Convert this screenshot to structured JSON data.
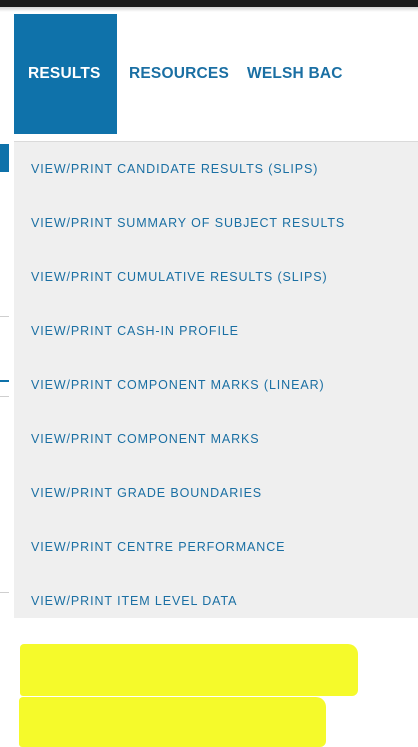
{
  "nav": {
    "tabs": [
      {
        "label": "RESULTS",
        "active": true
      },
      {
        "label": "RESOURCES",
        "active": false
      },
      {
        "label": "WELSH BAC",
        "active": false
      }
    ]
  },
  "dropdown": {
    "items": [
      {
        "label": "VIEW/PRINT CANDIDATE RESULTS (SLIPS)",
        "highlighted": false
      },
      {
        "label": "VIEW/PRINT SUMMARY OF SUBJECT RESULTS",
        "highlighted": false
      },
      {
        "label": "VIEW/PRINT CUMULATIVE RESULTS (SLIPS)",
        "highlighted": false
      },
      {
        "label": "VIEW/PRINT CASH-IN PROFILE",
        "highlighted": false
      },
      {
        "label": "VIEW/PRINT COMPONENT MARKS (LINEAR)",
        "highlighted": false
      },
      {
        "label": "VIEW/PRINT COMPONENT MARKS",
        "highlighted": false
      },
      {
        "label": "VIEW/PRINT GRADE BOUNDARIES",
        "highlighted": false
      },
      {
        "label": "VIEW/PRINT CENTRE PERFORMANCE",
        "highlighted": true
      },
      {
        "label": "VIEW/PRINT ITEM LEVEL DATA",
        "highlighted": true
      }
    ]
  },
  "colors": {
    "accent": "#0f72aa",
    "link": "#1a6fa3",
    "dropdown_bg": "#efefef",
    "highlight": "#f5fa2b"
  }
}
